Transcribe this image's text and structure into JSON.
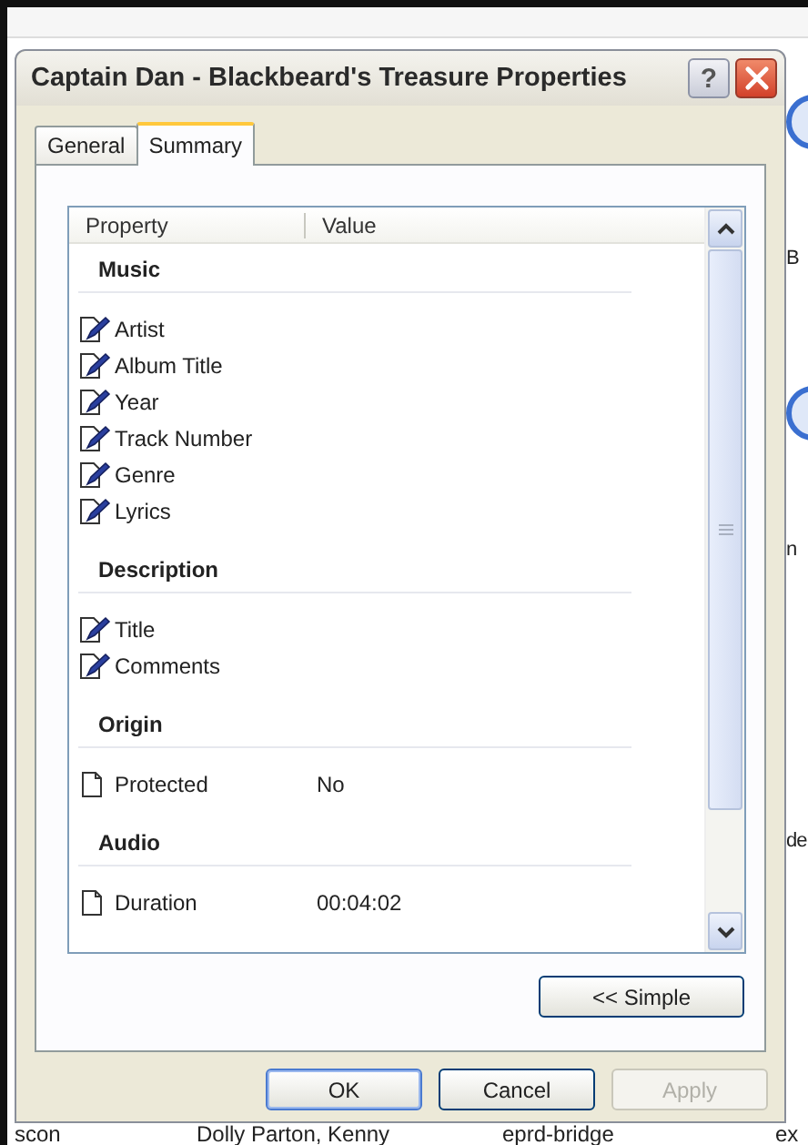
{
  "background": {
    "side_texts": [
      "B",
      "n",
      "de"
    ],
    "bottom_texts": [
      "scon",
      "Dolly Parton, Kenny",
      "eprd-bridge",
      "ex"
    ]
  },
  "dialog": {
    "title": "Captain Dan - Blackbeard's Treasure Properties",
    "help": "?",
    "tabs": [
      {
        "label": "General",
        "selected": false
      },
      {
        "label": "Summary",
        "selected": true
      }
    ],
    "columns": [
      "Property",
      "Value"
    ],
    "rows": [
      {
        "kind": "group",
        "label": "Music"
      },
      {
        "kind": "editable",
        "label": "Artist"
      },
      {
        "kind": "editable",
        "label": "Album Title"
      },
      {
        "kind": "editable",
        "label": "Year"
      },
      {
        "kind": "editable",
        "label": "Track Number"
      },
      {
        "kind": "editable",
        "label": "Genre"
      },
      {
        "kind": "editable",
        "label": "Lyrics"
      },
      {
        "kind": "group",
        "label": "Description"
      },
      {
        "kind": "editable",
        "label": "Title"
      },
      {
        "kind": "editable",
        "label": "Comments"
      },
      {
        "kind": "group",
        "label": "Origin"
      },
      {
        "kind": "readonly",
        "label": "Protected",
        "value": "No"
      },
      {
        "kind": "group",
        "label": "Audio"
      },
      {
        "kind": "readonly",
        "label": "Duration",
        "value": "00:04:02"
      }
    ],
    "simple_button": "<< Simple",
    "buttons": [
      {
        "label": "OK",
        "default": true,
        "disabled": false
      },
      {
        "label": "Cancel",
        "default": false,
        "disabled": false
      },
      {
        "label": "Apply",
        "default": false,
        "disabled": true
      }
    ]
  }
}
